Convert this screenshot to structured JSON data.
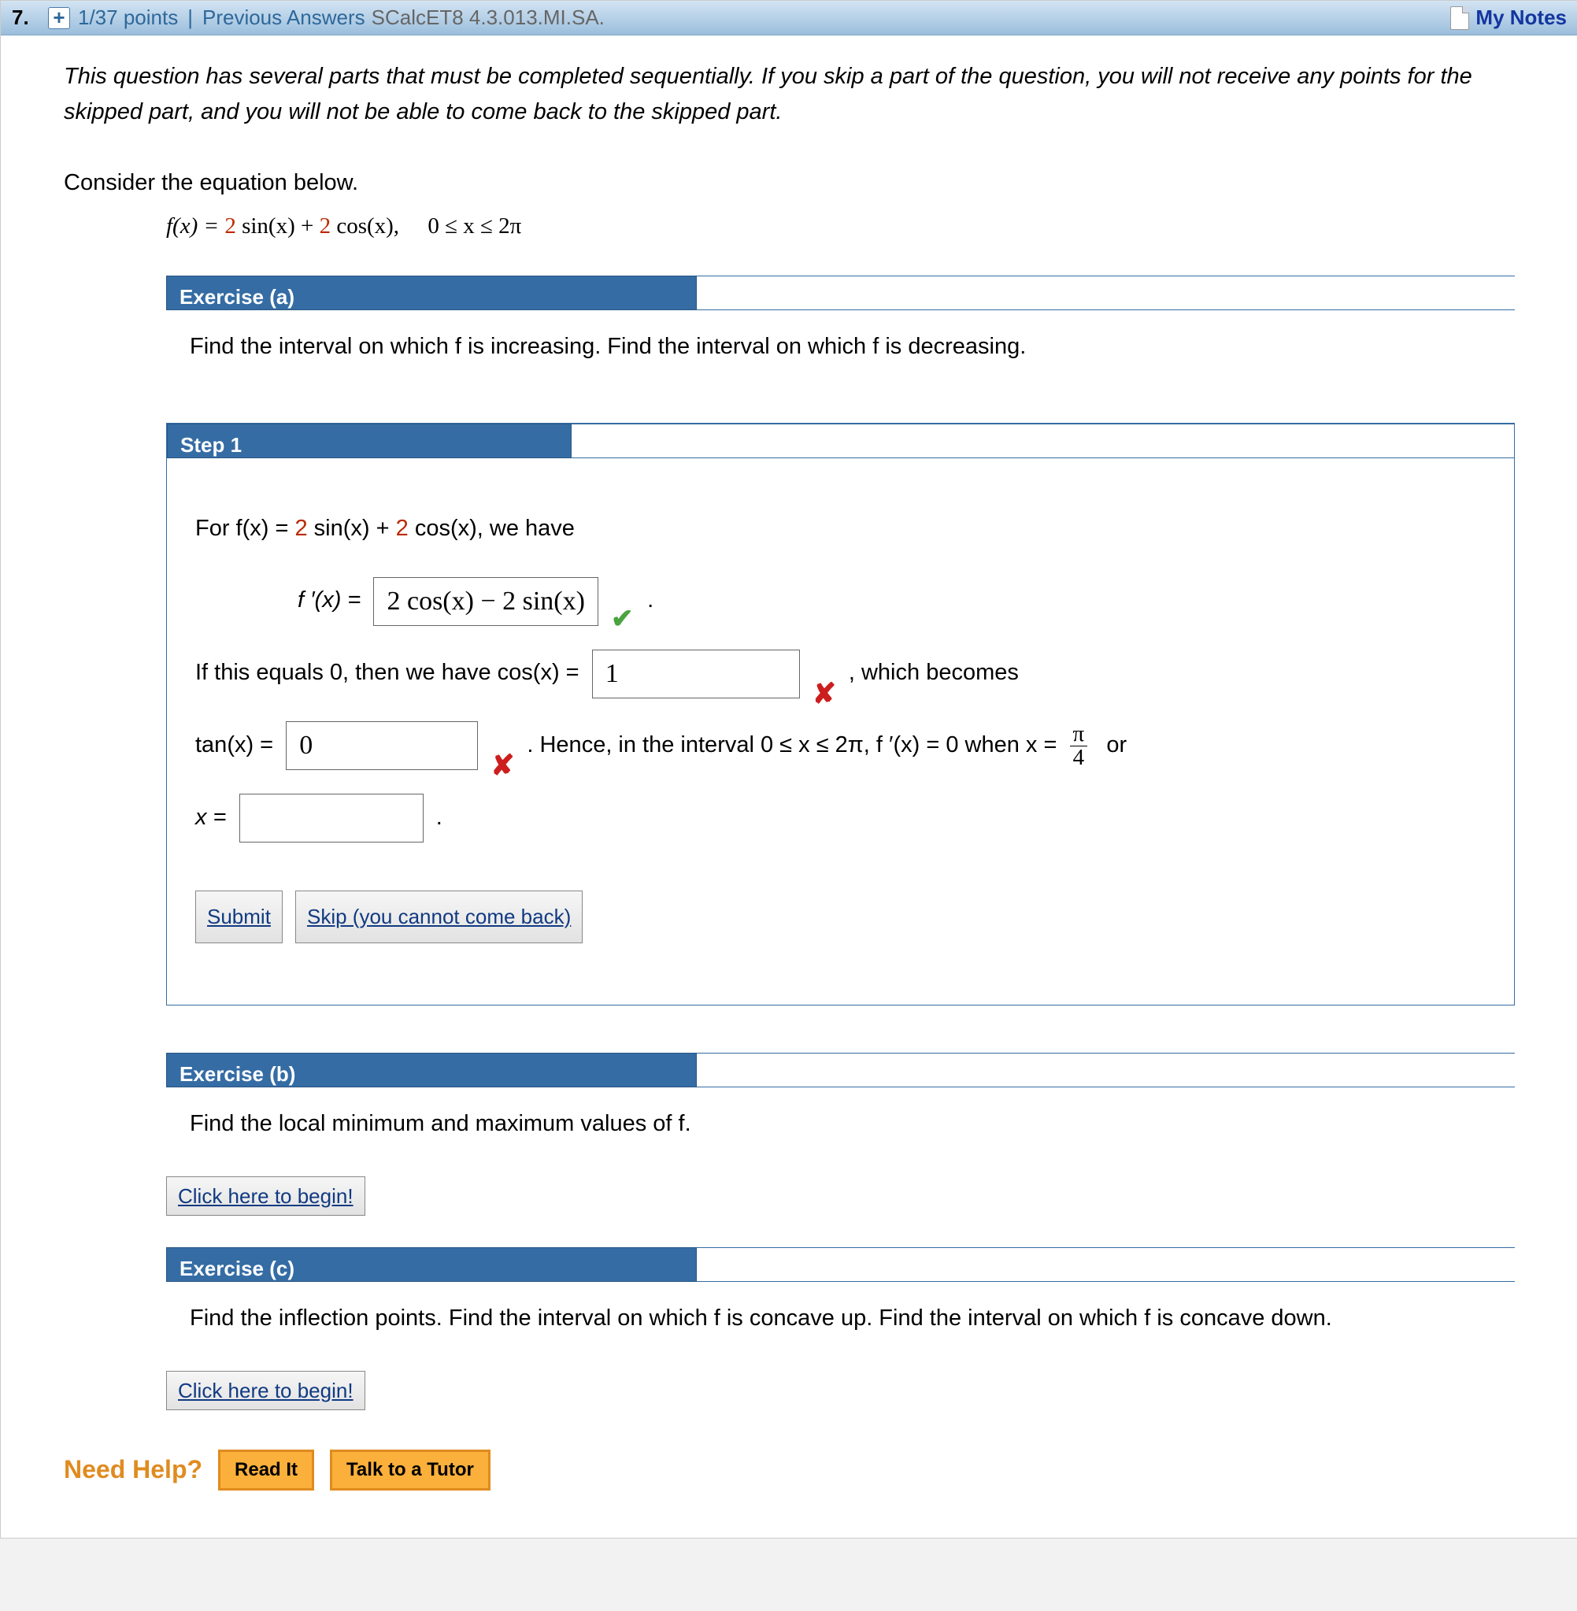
{
  "header": {
    "qnum": "7.",
    "points": "1/37 points",
    "prev_link": "Previous Answers",
    "source": "SCalcET8 4.3.013.MI.SA.",
    "notes": "My Notes"
  },
  "intro": "This question has several parts that must be completed sequentially. If you skip a part of the question, you will not receive any points for the skipped part, and you will not be able to come back to the skipped part.",
  "consider": "Consider the equation below.",
  "equation": {
    "prefix": "f(x) = ",
    "c1": "2",
    "t1": " sin(x) + ",
    "c2": "2",
    "t2": " cos(x),",
    "domain": "0 ≤ x ≤ 2π"
  },
  "ex_a": {
    "title": "Exercise (a)",
    "text": "Find the interval on which f is increasing. Find the interval on which f is decreasing."
  },
  "step1": {
    "title": "Step 1",
    "l1_pre": "For  f(x) = ",
    "l1_c1": "2",
    "l1_mid1": " sin(x) + ",
    "l1_c2": "2",
    "l1_mid2": " cos(x),  we have",
    "fp_label": "f ′(x)  =",
    "ans1": "2 cos(x) − 2 sin(x)",
    "l2_pre": "If this equals 0, then we have  cos(x)  =",
    "ans2": "1",
    "l2_post": ",   which becomes",
    "l3_pre": "tan(x)  =",
    "ans3": "0",
    "l3_mid": ".   Hence, in the interval 0 ≤ x ≤ 2π,  f ′(x) = 0  when  x =",
    "frac_n": "π",
    "frac_d": "4",
    "l3_end": "or",
    "l4_pre": "x  =",
    "l4_end": ".",
    "submit": "Submit",
    "skip": "Skip (you cannot come back)"
  },
  "ex_b": {
    "title": "Exercise (b)",
    "text": "Find the local minimum and maximum values of f.",
    "begin": "Click here to begin!"
  },
  "ex_c": {
    "title": "Exercise (c)",
    "text": "Find the inflection points. Find the interval on which f is concave up. Find the interval on which f is concave down.",
    "begin": "Click here to begin!"
  },
  "help": {
    "label": "Need Help?",
    "read": "Read It",
    "tutor": "Talk to a Tutor"
  }
}
